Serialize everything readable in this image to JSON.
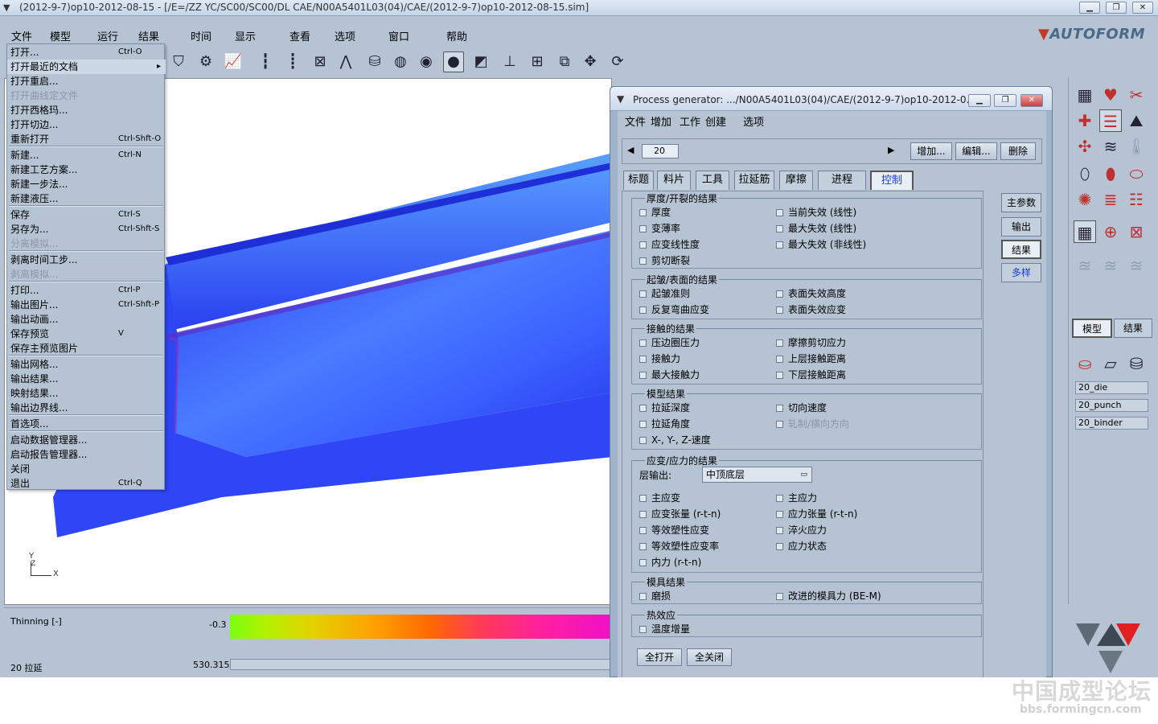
{
  "window": {
    "title": "(2012-9-7)op10-2012-08-15 - [/E=/ZZ YC/SC00/SC00/DL CAE/N00A5401L03(04)/CAE/(2012-9-7)op10-2012-08-15.sim]"
  },
  "menubar": [
    "文件",
    "模型",
    "运行",
    "结果",
    "时间",
    "显示",
    "查看",
    "选项",
    "窗口",
    "帮助"
  ],
  "brand": {
    "pre": "AUTO",
    "post": "FORM"
  },
  "file_menu": [
    {
      "label": "打开...",
      "shortcut": "Ctrl-O"
    },
    {
      "label": "打开最近的文档",
      "shortcut": ""
    },
    {
      "label": "打开重启...",
      "shortcut": ""
    },
    {
      "label": "打开曲线定文件",
      "shortcut": "",
      "disabled": true
    },
    {
      "label": "打开西格玛...",
      "shortcut": ""
    },
    {
      "label": "打开切边...",
      "shortcut": ""
    },
    {
      "label": "重新打开",
      "shortcut": "Ctrl-Shft-O"
    },
    {
      "label": "新建...",
      "shortcut": "Ctrl-N"
    },
    {
      "label": "新建工艺方案...",
      "shortcut": ""
    },
    {
      "label": "新建一步法...",
      "shortcut": ""
    },
    {
      "label": "新建液压...",
      "shortcut": ""
    },
    {
      "label": "保存",
      "shortcut": "Ctrl-S"
    },
    {
      "label": "另存为...",
      "shortcut": "Ctrl-Shft-S"
    },
    {
      "label": "分离模拟...",
      "shortcut": "",
      "disabled": true
    },
    {
      "label": "剥离时间工步...",
      "shortcut": ""
    },
    {
      "label": "剥离模拟...",
      "shortcut": "",
      "disabled": true
    },
    {
      "label": "打印...",
      "shortcut": "Ctrl-P"
    },
    {
      "label": "输出图片...",
      "shortcut": "Ctrl-Shft-P"
    },
    {
      "label": "输出动画...",
      "shortcut": ""
    },
    {
      "label": "保存预览",
      "shortcut": "V"
    },
    {
      "label": "保存主预览图片",
      "shortcut": ""
    },
    {
      "label": "输出网格...",
      "shortcut": ""
    },
    {
      "label": "输出结果...",
      "shortcut": ""
    },
    {
      "label": "映射结果...",
      "shortcut": ""
    },
    {
      "label": "输出边界线...",
      "shortcut": ""
    },
    {
      "label": "首选项...",
      "shortcut": ""
    },
    {
      "label": "启动数据管理器...",
      "shortcut": ""
    },
    {
      "label": "启动报告管理器...",
      "shortcut": ""
    },
    {
      "label": "关闭",
      "shortcut": ""
    },
    {
      "label": "退出",
      "shortcut": "Ctrl-Q"
    }
  ],
  "viewport": {
    "axis": {
      "y": "Y",
      "z": "Z",
      "x": "X"
    }
  },
  "legend": {
    "title": "Thinning [-]",
    "min_value": "-0.3",
    "step_label": "20 拉延",
    "progress_value": "530.315"
  },
  "dialog": {
    "title": "Process generator: .../N00A5401L03(04)/CAE/(2012-9-7)op10-2012-0...",
    "menu": [
      "文件",
      "增加",
      "工作",
      "创建",
      "选项"
    ],
    "step_value": "20",
    "step_buttons": [
      "增加...",
      "编辑...",
      "删除"
    ],
    "tabs": [
      "标题",
      "料片",
      "工具",
      "拉延筋",
      "摩擦",
      "进程",
      "控制"
    ],
    "side_buttons": [
      "主参数",
      "输出",
      "结果",
      "多样"
    ],
    "groups": [
      {
        "title": "厚度/开裂的结果",
        "items": [
          [
            "厚度",
            "当前失效 (线性)"
          ],
          [
            "变薄率",
            "最大失效 (线性)"
          ],
          [
            "应变线性度",
            "最大失效 (非线性)"
          ],
          [
            "剪切断裂",
            ""
          ]
        ]
      },
      {
        "title": "起皱/表面的结果",
        "items": [
          [
            "起皱准则",
            "表面失效高度"
          ],
          [
            "反复弯曲应变",
            "表面失效应变"
          ]
        ]
      },
      {
        "title": "接触的结果",
        "items": [
          [
            "压边圈压力",
            "摩擦剪切应力"
          ],
          [
            "接触力",
            "上层接触距离"
          ],
          [
            "最大接触力",
            "下层接触距离"
          ]
        ]
      },
      {
        "title": "模型结果",
        "items": [
          [
            "拉延深度",
            "切向速度"
          ],
          [
            "拉延角度",
            "轧制/横向方向"
          ],
          [
            "X-, Y-, Z-速度",
            ""
          ]
        ]
      },
      {
        "title": "应变/应力的结果",
        "layer_label": "层输出:",
        "layer_value": "中顶底层",
        "items": [
          [
            "主应变",
            "主应力"
          ],
          [
            "应变张量 (r-t-n)",
            "应力张量 (r-t-n)"
          ],
          [
            "等效塑性应变",
            "淬火应力"
          ],
          [
            "等效塑性应变率",
            "应力状态"
          ],
          [
            "内力 (r-t-n)",
            ""
          ]
        ]
      },
      {
        "title": "模具结果",
        "items": [
          [
            "磨损",
            "改进的模具力 (BE-M)"
          ]
        ]
      },
      {
        "title": "热效应",
        "items": [
          [
            "温度增量",
            ""
          ]
        ]
      }
    ],
    "footer_buttons": [
      "全打开",
      "全关闭"
    ]
  },
  "right_panel": {
    "tabs": [
      "模型",
      "结果"
    ],
    "objects": [
      "20_die",
      "20_punch",
      "20_binder"
    ]
  },
  "watermark": {
    "text": "中国成型论坛",
    "url": "bbs.formingcn.com"
  },
  "colors": {
    "accent_blue": "#1a40c8",
    "surface_blue": "#3a55ff",
    "panel_bg": "#b5c3d3"
  }
}
